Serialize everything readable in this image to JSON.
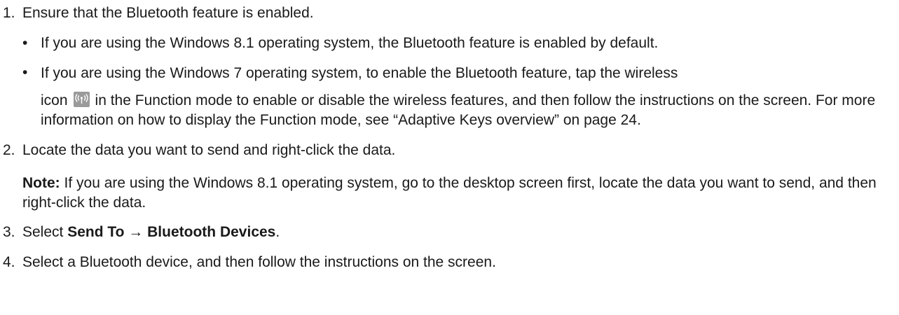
{
  "steps": [
    {
      "num": "1.",
      "text": "Ensure that the Bluetooth feature is enabled.",
      "bullets": [
        {
          "dot": "•",
          "text": "If you are using the Windows 8.1 operating system, the Bluetooth feature is enabled by default."
        },
        {
          "dot": "•",
          "line1": "If you are using the Windows 7 operating system, to enable the Bluetooth feature, tap the wireless",
          "before_icon": "icon",
          "icon": "wireless-icon",
          "after_icon": "in the Function mode to enable or disable the wireless features, and then follow the instructions on the screen. For more information on how to display the Function mode, see “Adaptive Keys overview” on page 24."
        }
      ]
    },
    {
      "num": "2.",
      "text": "Locate the data you want to send and right-click the data.",
      "note_label": "Note:",
      "note_text": " If you are using the Windows 8.1 operating system, go to the desktop screen first, locate the data you want to send, and then right-click the data."
    },
    {
      "num": "3.",
      "text_prefix": "Select ",
      "bold_text": "Send To → Bluetooth Devices",
      "text_suffix": "."
    },
    {
      "num": "4.",
      "text": "Select a Bluetooth device, and then follow the instructions on the screen."
    }
  ]
}
